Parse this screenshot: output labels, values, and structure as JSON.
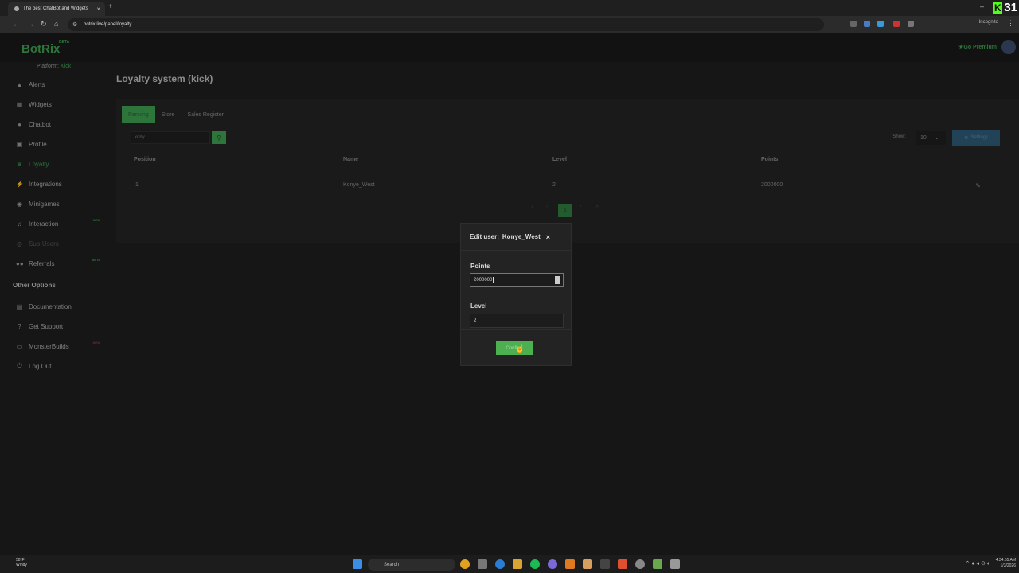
{
  "browser": {
    "tab_title": "The best ChatBot and Widgets",
    "tab_close": "×",
    "new_tab": "+",
    "url": "botrix.live/panel/loyalty",
    "incognito": "Incognito",
    "window_min": "–",
    "kick_badge_letter": "K",
    "kick_badge_count": "31"
  },
  "header": {
    "logo": "BotRix",
    "beta": "BETA",
    "premium": "Go Premium",
    "platform_label": "Platform:",
    "platform_value": "Kick"
  },
  "sidebar": {
    "items": [
      {
        "label": "Alerts",
        "icon": "warning-icon"
      },
      {
        "label": "Widgets",
        "icon": "grid-icon"
      },
      {
        "label": "Chatbot",
        "icon": "robot-icon"
      },
      {
        "label": "Profile",
        "icon": "id-card-icon"
      },
      {
        "label": "Loyalty",
        "icon": "trophy-icon"
      },
      {
        "label": "Integrations",
        "icon": "plug-icon"
      },
      {
        "label": "Minigames",
        "icon": "gamepad-icon"
      },
      {
        "label": "Interaction",
        "icon": "music-icon",
        "tag": "NEW"
      },
      {
        "label": "Sub-Users",
        "icon": "users-icon"
      },
      {
        "label": "Referrals",
        "icon": "group-icon",
        "tag": "BETA"
      }
    ],
    "other_heading": "Other Options",
    "other_items": [
      {
        "label": "Documentation",
        "icon": "book-icon"
      },
      {
        "label": "Get Support",
        "icon": "question-icon"
      },
      {
        "label": "MonsterBuilds",
        "icon": "laptop-icon",
        "tag": "NEW"
      },
      {
        "label": "Log Out",
        "icon": "power-icon"
      }
    ]
  },
  "main": {
    "title": "Loyalty system (kick)",
    "tabs": [
      "Ranking",
      "Store",
      "Sales Register"
    ],
    "search_value": "kony",
    "show_label": "Show:",
    "show_value": "10",
    "settings_label": "Settings",
    "columns": [
      "Position",
      "Name",
      "Level",
      "Points"
    ],
    "rows": [
      {
        "position": "1",
        "name": "Konye_West",
        "level": "2",
        "points": "2000000"
      }
    ],
    "pager": [
      "«",
      "‹",
      "1",
      "›",
      "»"
    ]
  },
  "modal": {
    "title": "Edit user:",
    "user": "Konye_West",
    "close": "×",
    "points_label": "Points",
    "points_value": "2000000",
    "level_label": "Level",
    "level_value": "2",
    "confirm_label": "Confirm"
  },
  "taskbar": {
    "weather_temp": "58°F",
    "weather_desc": "Windy",
    "search": "Search",
    "time": "4:34:55 AM",
    "date": "1/3/2026"
  },
  "colors": {
    "accent_green": "#3d9c4f",
    "settings_blue": "#2c5874",
    "background": "#1e1e1e"
  }
}
